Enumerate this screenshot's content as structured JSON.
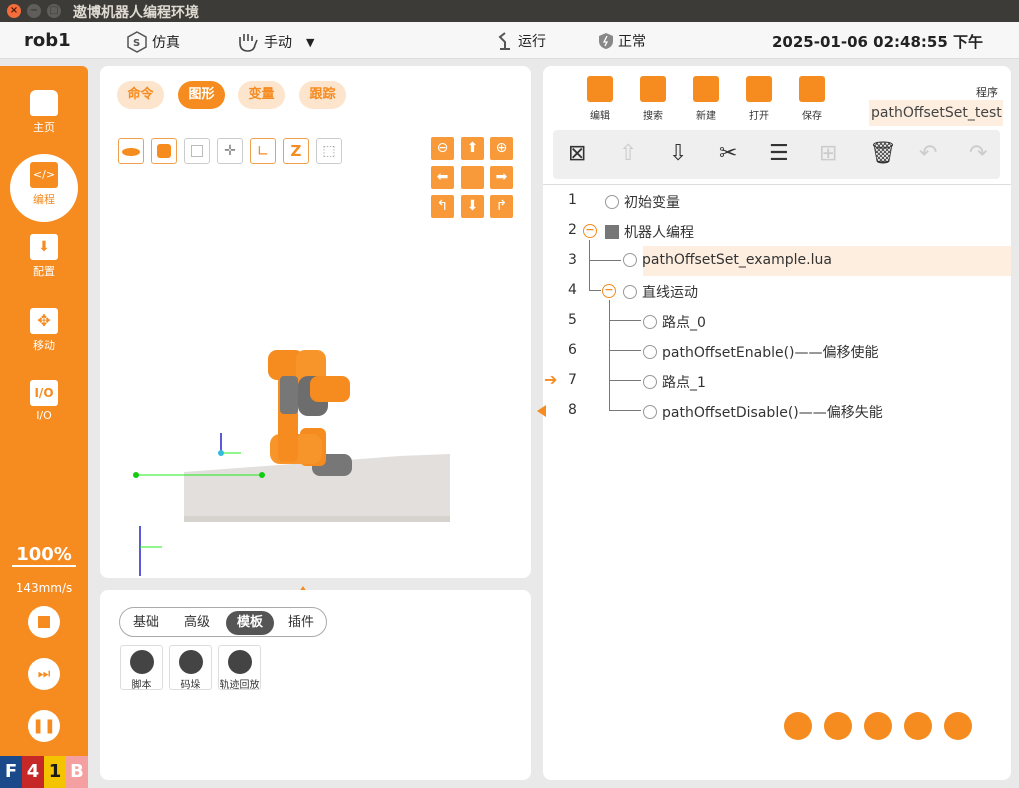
{
  "window": {
    "title": "遨博机器人编程环境"
  },
  "header": {
    "robot_name": "rob1",
    "sim_label": "仿真",
    "mode_label": "手动",
    "run_label": "运行",
    "status_label": "正常",
    "datetime": "2025-01-06 02:48:55 下午"
  },
  "sidebar": {
    "items": [
      {
        "label": "主页",
        "icon": "home-icon"
      },
      {
        "label": "编程",
        "icon": "code-icon"
      },
      {
        "label": "配置",
        "icon": "config-icon"
      },
      {
        "label": "移动",
        "icon": "move-icon"
      },
      {
        "label": "I/O",
        "icon": "io-icon"
      }
    ],
    "speed_percent": "100%",
    "speed_value": "143mm/s",
    "badge": [
      "F",
      "4",
      "1",
      "B"
    ]
  },
  "graphics": {
    "tabs": [
      "命令",
      "图形",
      "变量",
      "跟踪"
    ],
    "active_tab": "图形"
  },
  "bottom": {
    "tabs": [
      "基础",
      "高级",
      "模板",
      "插件"
    ],
    "active_tab": "模板",
    "tools": [
      "脚本",
      "码垛",
      "轨迹回放"
    ]
  },
  "program": {
    "tools": [
      "编辑",
      "搜索",
      "新建",
      "打开",
      "保存"
    ],
    "label": "程序",
    "name": "pathOffsetSet_test",
    "lines": [
      {
        "num": "1",
        "text": "初始变量"
      },
      {
        "num": "2",
        "text": "机器人编程"
      },
      {
        "num": "3",
        "text": "pathOffsetSet_example.lua"
      },
      {
        "num": "4",
        "text": "直线运动"
      },
      {
        "num": "5",
        "text": "路点_0"
      },
      {
        "num": "6",
        "text": "pathOffsetEnable()——偏移使能"
      },
      {
        "num": "7",
        "text": "路点_1"
      },
      {
        "num": "8",
        "text": "pathOffsetDisable()——偏移失能"
      }
    ]
  },
  "colors": {
    "accent": "#f68b1f",
    "badge_red": "#c62828",
    "badge_blue": "#1a4a8a",
    "badge_yellow": "#f5c400"
  }
}
